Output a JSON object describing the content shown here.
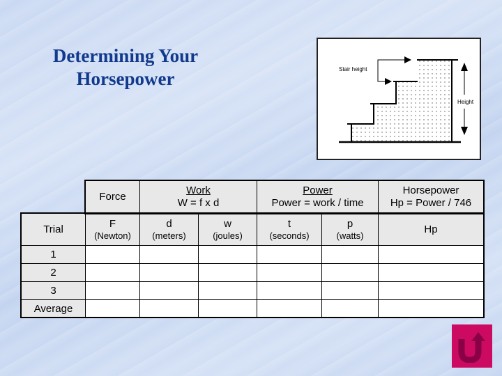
{
  "slide": {
    "title_line1": "Determining Your",
    "title_line2": "Horsepower"
  },
  "diagram": {
    "stair_label": "Stair height",
    "height_label": "Height"
  },
  "table": {
    "group_headers": {
      "force": "Force",
      "work_title": "Work",
      "work_formula": "W = f x d",
      "power_title": "Power",
      "power_formula": "Power = work / time",
      "hp_title": "Horsepower",
      "hp_formula": "Hp = Power / 746"
    },
    "columns": [
      {
        "symbol": "Trial",
        "unit": ""
      },
      {
        "symbol": "F",
        "unit": "(Newton)"
      },
      {
        "symbol": "d",
        "unit": "(meters)"
      },
      {
        "symbol": "w",
        "unit": "(joules)"
      },
      {
        "symbol": "t",
        "unit": "(seconds)"
      },
      {
        "symbol": "p",
        "unit": "(watts)"
      },
      {
        "symbol": "Hp",
        "unit": ""
      }
    ],
    "rows": [
      {
        "label": "1",
        "values": [
          "",
          "",
          "",
          "",
          "",
          ""
        ]
      },
      {
        "label": "2",
        "values": [
          "",
          "",
          "",
          "",
          "",
          ""
        ]
      },
      {
        "label": "3",
        "values": [
          "",
          "",
          "",
          "",
          "",
          ""
        ]
      },
      {
        "label": "Average",
        "values": [
          "",
          "",
          "",
          "",
          "",
          ""
        ]
      }
    ]
  },
  "nav": {
    "back_icon": "u-turn-arrow-icon",
    "accent_color": "#cc0a62"
  }
}
